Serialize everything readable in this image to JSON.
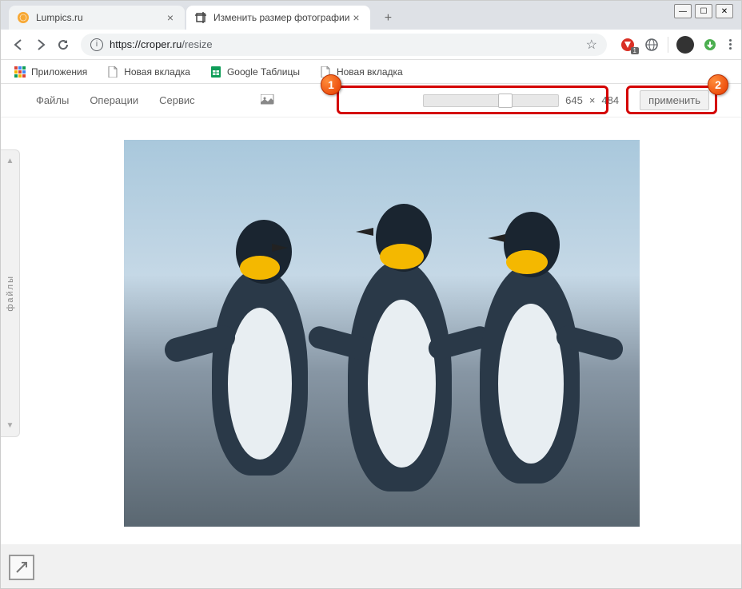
{
  "window": {
    "minimize": "—",
    "maximize": "☐",
    "close": "✕"
  },
  "tabs": [
    {
      "title": "Lumpics.ru",
      "favicon": "orange"
    },
    {
      "title": "Изменить размер фотографии",
      "favicon": "crop"
    }
  ],
  "toolbar": {
    "address_host": "https://croper.ru",
    "address_path": "/resize",
    "info": "i",
    "star": "☆",
    "ext_badge": "1"
  },
  "bookmarks": [
    {
      "label": "Приложения",
      "icon": "apps"
    },
    {
      "label": "Новая вкладка",
      "icon": "page"
    },
    {
      "label": "Google Таблицы",
      "icon": "sheets"
    },
    {
      "label": "Новая вкладка",
      "icon": "page"
    }
  ],
  "app": {
    "menus": [
      "Файлы",
      "Операции",
      "Сервис"
    ],
    "width": "645",
    "height": "484",
    "separator": "×",
    "apply_label": "применить"
  },
  "sidebar": {
    "label": "файлы",
    "up": "▲",
    "down": "▼"
  },
  "annotations": {
    "badge1": "1",
    "badge2": "2"
  }
}
